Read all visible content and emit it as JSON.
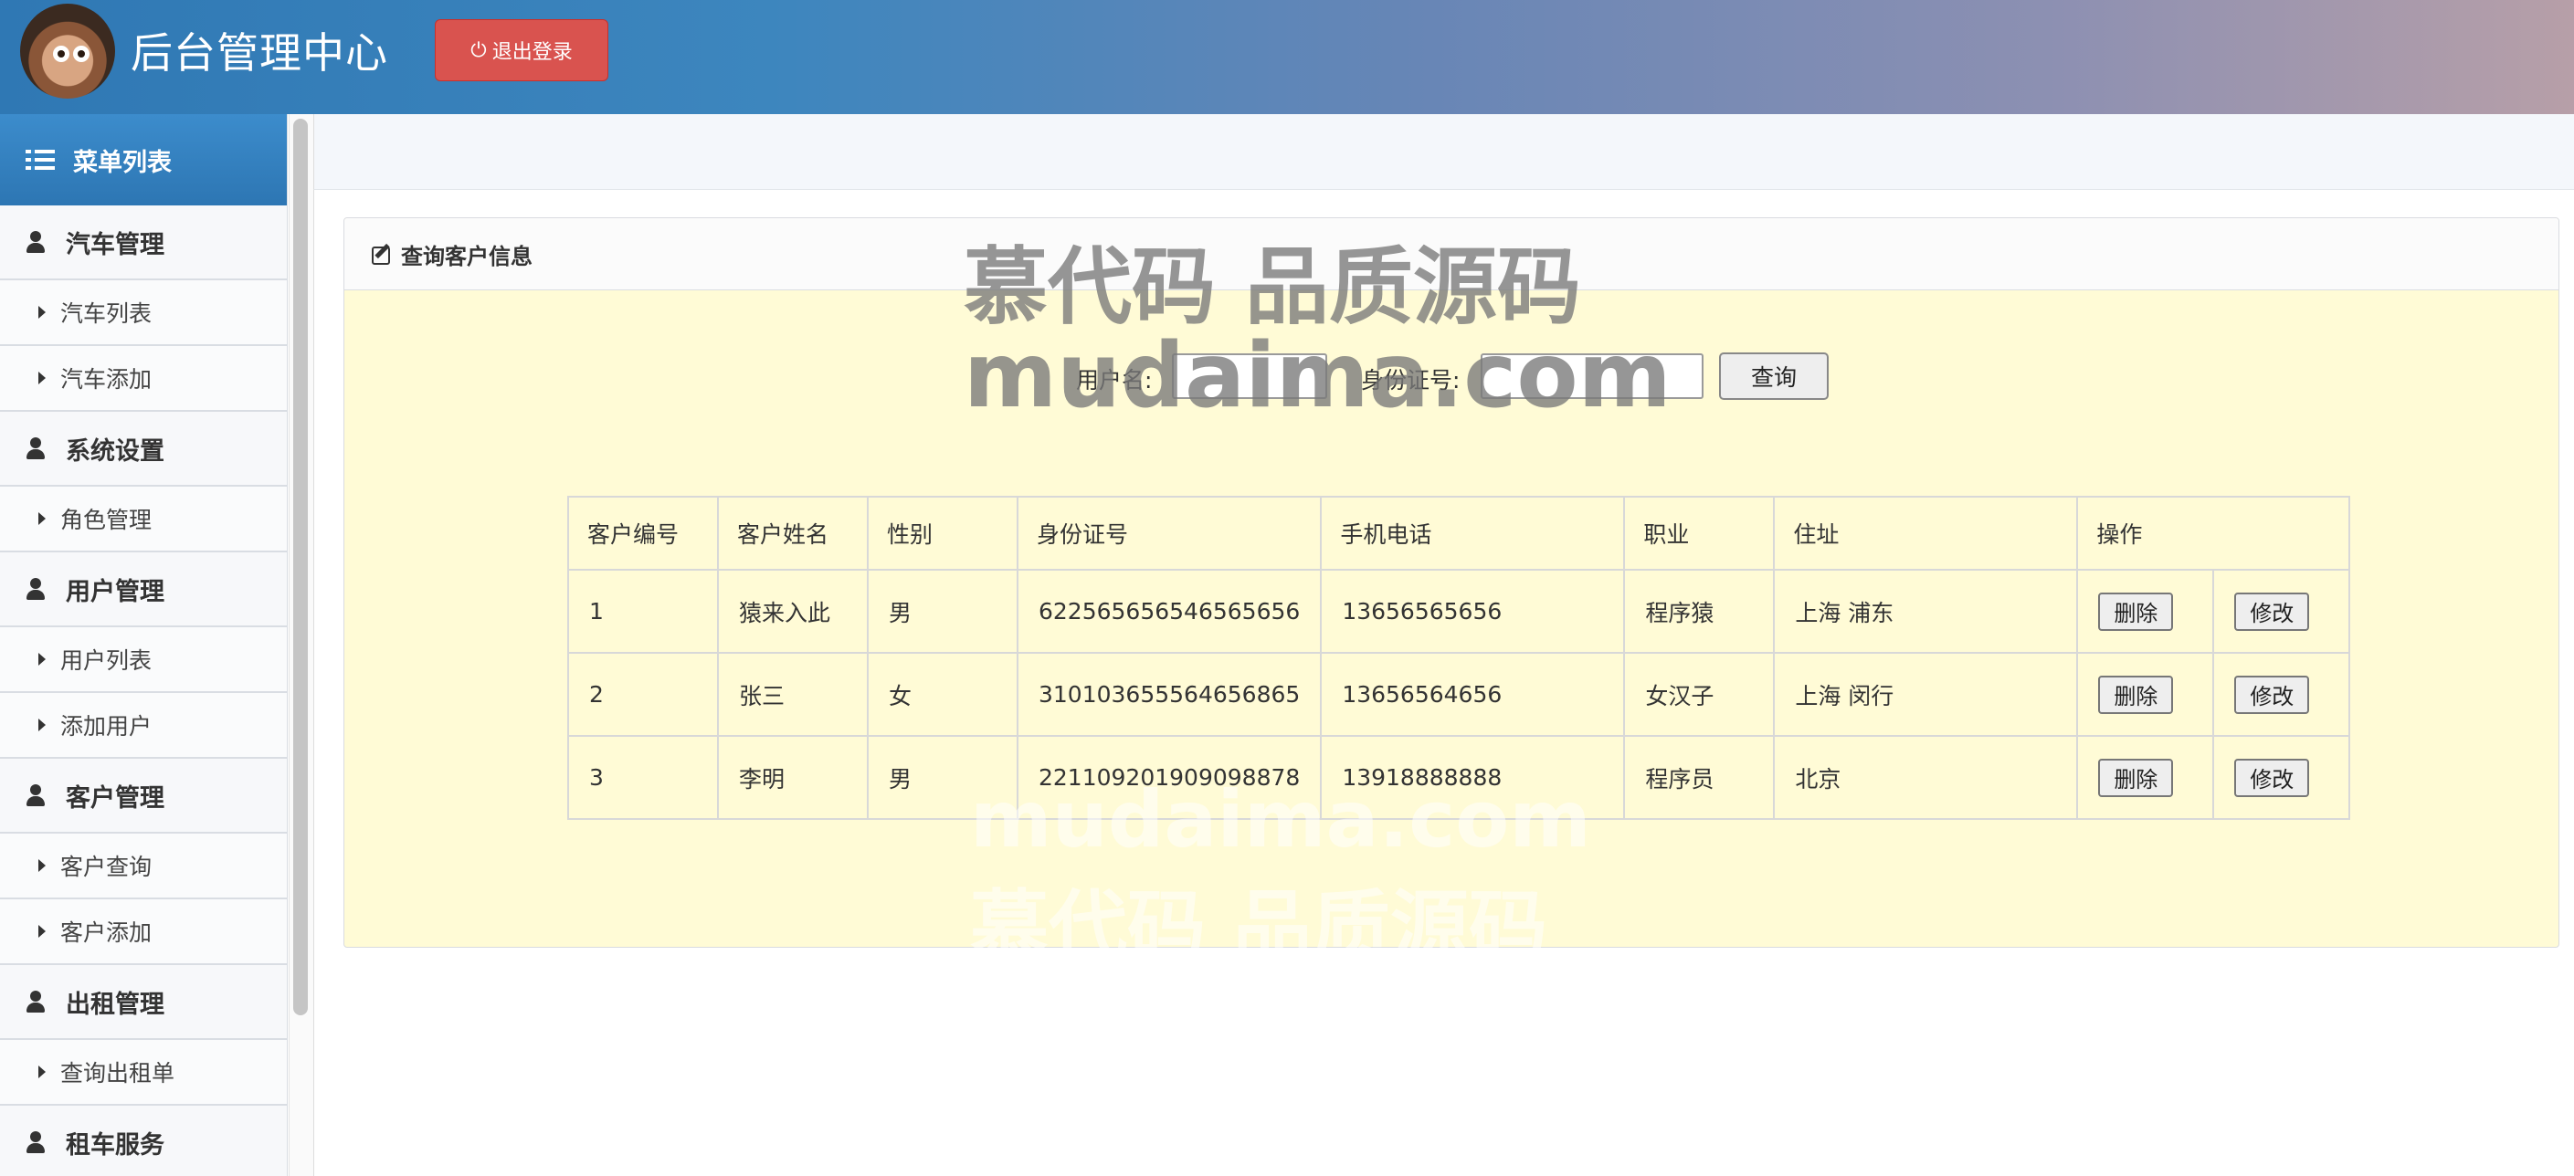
{
  "header": {
    "title": "后台管理中心",
    "logout_label": "退出登录"
  },
  "sidebar": {
    "menu_title": "菜单列表",
    "groups": [
      {
        "label": "汽车管理",
        "items": [
          "汽车列表",
          "汽车添加"
        ]
      },
      {
        "label": "系统设置",
        "items": [
          "角色管理"
        ]
      },
      {
        "label": "用户管理",
        "items": [
          "用户列表",
          "添加用户"
        ]
      },
      {
        "label": "客户管理",
        "items": [
          "客户查询",
          "客户添加"
        ]
      },
      {
        "label": "出租管理",
        "items": [
          "查询出租单"
        ]
      },
      {
        "label": "租车服务",
        "items": []
      }
    ]
  },
  "panel": {
    "title": "查询客户信息",
    "search": {
      "username_label": "用户名:",
      "username_value": "",
      "idcard_label": "身份证号:",
      "idcard_value": "",
      "query_label": "查询"
    },
    "table": {
      "columns": [
        "客户编号",
        "客户姓名",
        "性别",
        "身份证号",
        "手机电话",
        "职业",
        "住址",
        "操作"
      ],
      "rows": [
        [
          "1",
          "猿来入此",
          "男",
          "622565656546565656",
          "13656565656",
          "程序猿",
          "上海 浦东"
        ],
        [
          "2",
          "张三",
          "女",
          "310103655564656865",
          "13656564656",
          "女汉子",
          "上海 闵行"
        ],
        [
          "3",
          "李明",
          "男",
          "221109201909098878",
          "13918888888",
          "程序员",
          "北京"
        ]
      ],
      "delete_label": "删除",
      "edit_label": "修改"
    }
  },
  "watermark": {
    "line1": "慕代码 品质源码",
    "line2": "mudaima.com"
  },
  "colors": {
    "header_start": "#2f78b4",
    "header_end": "#b79fa8",
    "logout": "#d9534f",
    "menu_header": "#3c8ccc",
    "panel_body": "#fffbd6"
  }
}
